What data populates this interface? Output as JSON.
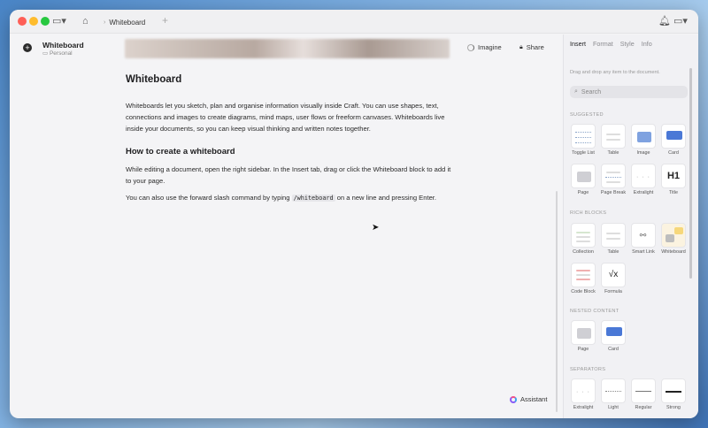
{
  "titlebar": {
    "tab_label": "Whiteboard"
  },
  "doc": {
    "title": "Whiteboard",
    "space": "Personal"
  },
  "toolbar": {
    "imagine_label": "Imagine",
    "share_label": "Share"
  },
  "article": {
    "heading": "Whiteboard",
    "intro": "Whiteboards let you sketch, plan and organise information visually inside Craft. You can use shapes, text, connections and images to create diagrams, mind maps, user flows or freeform canvases. Whiteboards live inside your documents, so you can keep visual thinking and written notes together.",
    "subheading": "How to create a whiteboard",
    "step1": "While editing a document, open the right sidebar. In the Insert tab, drag or click the Whiteboard block to add it to your page.",
    "step2_before": "You can also use the forward slash command by typing",
    "step2_code": "/whiteboard",
    "step2_after": "on a new line and pressing Enter."
  },
  "assistant_label": "Assistant",
  "sidebar": {
    "tabs": [
      "Insert",
      "Format",
      "Style",
      "Info"
    ],
    "hint": "Drag and drop any item to the document.",
    "search_placeholder": "Search",
    "sections": {
      "suggested": "SUGGESTED",
      "rich": "RICH BLOCKS",
      "nested": "NESTED CONTENT",
      "separators": "SEPARATORS"
    },
    "suggested_items": [
      "Toggle List",
      "Table",
      "Image",
      "Card",
      "Page",
      "Page Break",
      "Extralight",
      "Title"
    ],
    "title_glyph": "H1",
    "rich_items": [
      "Collection",
      "Table",
      "Smart Link",
      "Whiteboard",
      "Code Block",
      "Formula"
    ],
    "formula_glyph": "√x",
    "nested_items": [
      "Page",
      "Card"
    ],
    "separator_items": [
      "Extralight",
      "Light",
      "Regular",
      "Strong"
    ]
  }
}
